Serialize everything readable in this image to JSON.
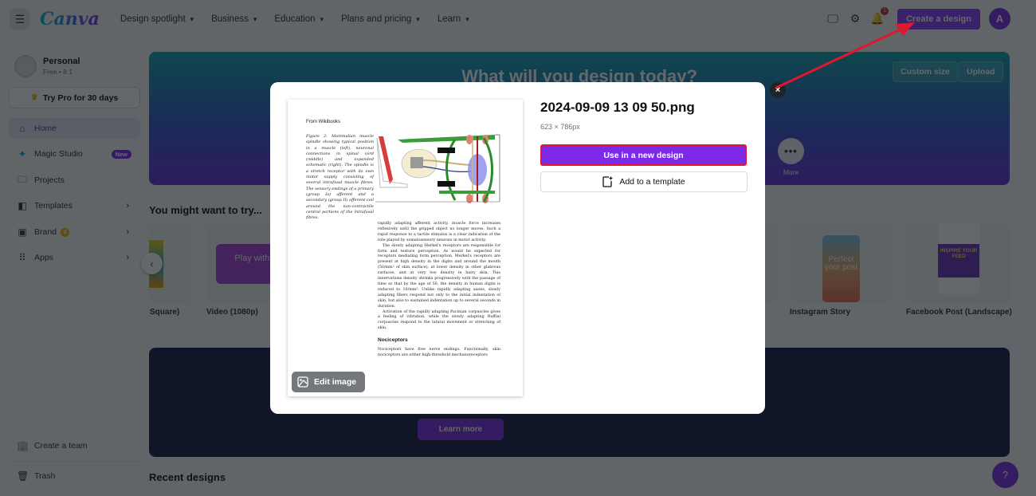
{
  "topbar": {
    "logo": "Canva",
    "nav": [
      {
        "label": "Design spotlight"
      },
      {
        "label": "Business"
      },
      {
        "label": "Education"
      },
      {
        "label": "Plans and pricing"
      },
      {
        "label": "Learn"
      }
    ],
    "notification_count": "1",
    "create_label": "Create a design",
    "avatar_initial": "A"
  },
  "sidebar": {
    "profile_name": "Personal",
    "profile_sub": "Free • 8 1",
    "try_pro": "Try Pro for 30 days",
    "items": [
      {
        "label": "Home",
        "icon": "home-icon"
      },
      {
        "label": "Magic Studio",
        "icon": "sparkle-icon",
        "tag": "New"
      },
      {
        "label": "Projects",
        "icon": "folder-icon"
      },
      {
        "label": "Templates",
        "icon": "templates-icon"
      },
      {
        "label": "Brand",
        "icon": "brand-icon"
      },
      {
        "label": "Apps",
        "icon": "apps-icon"
      }
    ],
    "create_team": "Create a team",
    "trash": "Trash"
  },
  "hero": {
    "title": "What will you design today?",
    "custom_size": "Custom size",
    "upload": "Upload",
    "more": "More"
  },
  "suggestions": {
    "title": "You might want to try...",
    "cards": [
      {
        "label": "Square)"
      },
      {
        "label": "Video (1080p)",
        "thumb_text": "Play with video"
      },
      {
        "label": "Instagram Story",
        "thumb_text": "Perfect your post"
      },
      {
        "label": "Facebook Post (Landscape)",
        "thumb_text": "INSPIRE YOUR FEED"
      }
    ]
  },
  "promo": {
    "learn_more": "Learn more"
  },
  "recent": {
    "title": "Recent designs"
  },
  "help": "?",
  "modal": {
    "file_name": "2024-09-09 13 09 50.png",
    "dimensions": "623 × 786px",
    "use_button": "Use in a new design",
    "template_button": "Add to a template",
    "edit_image": "Edit image",
    "close": "×",
    "preview": {
      "source": "From Wikibooks",
      "caption": "Figure 2: Mammalian muscle spindle showing typical position in a muscle (left), neuronal connections in spinal cord (middle) and expanded schematic (right). The spindle is a stretch receptor with its own motor supply consisting of several intrafusal muscle fibres. The sensory endings of a primary (group Ia) afferent and a secondary (group II) afferent coil around the non-contractile central portions of the intrafusal fibres.",
      "para1": "rapidly adapting afferent activity, muscle force increases reflexively until the gripped object no longer moves. Such a rapid response to a tactile stimulus is a clear indication of the role played by somatosensory neurons in motor activity.",
      "para2": "The slowly adapting Merkel's receptors are responsible for form and texture perception. As would be expected for receptors mediating form perception, Merkel's receptors are present at high density in the digits and around the mouth (50/mm² of skin surface), at lower density in other glabrous surfaces, and at very low density in hairy skin. This innervations density shrinks progressively with the passage of time so that by the age of 50, the density in human digits is reduced to 10/mm². Unlike rapidly adapting axons, slowly adapting fibers respond not only to the initial indentation of skin, but also to sustained indentation up to several seconds in duration.",
      "para3": "Activation of the rapidly adapting Pacinian corpuscles gives a feeling of vibration, while the slowly adapting Ruffini corpuscles respond to the lataral movement or stretching of skin.",
      "heading": "Nociceptors",
      "para4": "Nociceptors have free nerve endings. Functionally, skin nociceptors are either high-threshold mechanoreceptors"
    }
  },
  "colors": {
    "accent": "#7d2ae8",
    "highlight_border": "#e0172f",
    "annotation_arrow": "#e0172f"
  }
}
